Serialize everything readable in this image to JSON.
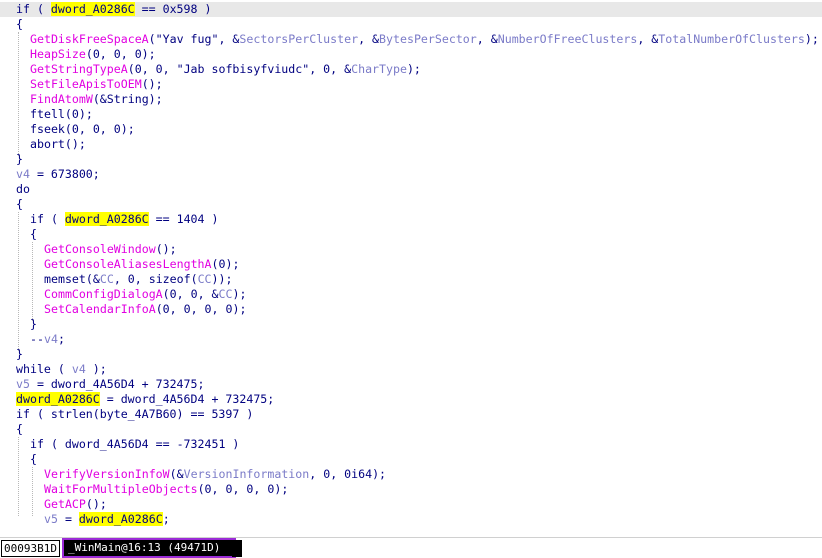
{
  "code_lines": [
    [
      [
        "kw",
        "if ( "
      ],
      [
        "hl",
        "dword_A0286C"
      ],
      [
        "kw",
        " == 0x598 )"
      ]
    ],
    [
      [
        "kw",
        "{"
      ]
    ],
    [
      [
        "func",
        "GetDiskFreeSpaceA"
      ],
      [
        "kw",
        "(\"Yav fug\", &"
      ],
      [
        "var",
        "SectorsPerCluster"
      ],
      [
        "kw",
        ", &"
      ],
      [
        "var",
        "BytesPerSector"
      ],
      [
        "kw",
        ", &"
      ],
      [
        "var",
        "NumberOfFreeClusters"
      ],
      [
        "kw",
        ", &"
      ],
      [
        "var",
        "TotalNumberOfClusters"
      ],
      [
        "kw",
        ");"
      ]
    ],
    [
      [
        "func",
        "HeapSize"
      ],
      [
        "kw",
        "(0, 0, 0);"
      ]
    ],
    [
      [
        "func",
        "GetStringTypeA"
      ],
      [
        "kw",
        "(0, 0, \"Jab sofbisyfviudc\", 0, &"
      ],
      [
        "var",
        "CharType"
      ],
      [
        "kw",
        ");"
      ]
    ],
    [
      [
        "func",
        "SetFileApisToOEM"
      ],
      [
        "kw",
        "();"
      ]
    ],
    [
      [
        "func",
        "FindAtomW"
      ],
      [
        "kw",
        "(&String);"
      ]
    ],
    [
      [
        "kw",
        "ftell(0);"
      ]
    ],
    [
      [
        "kw",
        "fseek(0, 0, 0);"
      ]
    ],
    [
      [
        "kw",
        "abort();"
      ]
    ],
    [
      [
        "kw",
        "}"
      ]
    ],
    [
      [
        "var",
        "v4"
      ],
      [
        "kw",
        " = 673800;"
      ]
    ],
    [
      [
        "kw",
        "do"
      ]
    ],
    [
      [
        "kw",
        "{"
      ]
    ],
    [
      [
        "kw",
        "if ( "
      ],
      [
        "hl",
        "dword_A0286C"
      ],
      [
        "kw",
        " == 1404 )"
      ]
    ],
    [
      [
        "kw",
        "{"
      ]
    ],
    [
      [
        "func",
        "GetConsoleWindow"
      ],
      [
        "kw",
        "();"
      ]
    ],
    [
      [
        "func",
        "GetConsoleAliasesLengthA"
      ],
      [
        "kw",
        "(0);"
      ]
    ],
    [
      [
        "kw",
        "memset(&"
      ],
      [
        "var",
        "CC"
      ],
      [
        "kw",
        ", 0, sizeof("
      ],
      [
        "var",
        "CC"
      ],
      [
        "kw",
        "));"
      ]
    ],
    [
      [
        "func",
        "CommConfigDialogA"
      ],
      [
        "kw",
        "(0, 0, &"
      ],
      [
        "var",
        "CC"
      ],
      [
        "kw",
        ");"
      ]
    ],
    [
      [
        "func",
        "SetCalendarInfoA"
      ],
      [
        "kw",
        "(0, 0, 0, 0);"
      ]
    ],
    [
      [
        "kw",
        "}"
      ]
    ],
    [
      [
        "kw",
        "--"
      ],
      [
        "var",
        "v4"
      ],
      [
        "kw",
        ";"
      ]
    ],
    [
      [
        "kw",
        "}"
      ]
    ],
    [
      [
        "kw",
        "while ( "
      ],
      [
        "var",
        "v4"
      ],
      [
        "kw",
        " );"
      ]
    ],
    [
      [
        "var",
        "v5"
      ],
      [
        "kw",
        " = dword_4A56D4 + 732475;"
      ]
    ],
    [
      [
        "hl",
        "dword_A0286C"
      ],
      [
        "kw",
        " = dword_4A56D4 + 732475;"
      ]
    ],
    [
      [
        "kw",
        "if ( strlen(byte_4A7B60) == 5397 )"
      ]
    ],
    [
      [
        "kw",
        "{"
      ]
    ],
    [
      [
        "kw",
        "if ( dword_4A56D4 == -732451 )"
      ]
    ],
    [
      [
        "kw",
        "{"
      ]
    ],
    [
      [
        "func",
        "VerifyVersionInfoW"
      ],
      [
        "kw",
        "(&"
      ],
      [
        "var",
        "VersionInformation"
      ],
      [
        "kw",
        ", 0, 0i64);"
      ]
    ],
    [
      [
        "func",
        "WaitForMultipleObjects"
      ],
      [
        "kw",
        "(0, 0, 0, 0);"
      ]
    ],
    [
      [
        "func",
        "GetACP"
      ],
      [
        "kw",
        "();"
      ]
    ],
    [
      [
        "var",
        "v5"
      ],
      [
        "kw",
        " = "
      ],
      [
        "hl",
        "dword_A0286C"
      ],
      [
        "kw",
        ";"
      ]
    ]
  ],
  "status": {
    "address": "00093B1D",
    "location": "_WinMain@16:13 (49471D)"
  }
}
